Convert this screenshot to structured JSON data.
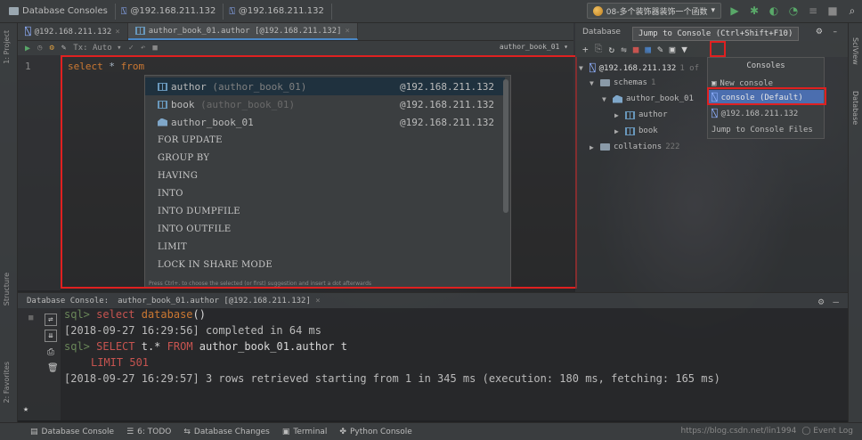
{
  "navbar": {
    "crumbs": [
      "Database Consoles",
      "@192.168.211.132",
      "@192.168.211.132"
    ],
    "connection_dropdown": "08-多个装饰器装饰一个函数"
  },
  "left_strip": {
    "project": "1: Project",
    "structure": "Structure",
    "favorites": "2: Favorites"
  },
  "right_strip": {
    "sciview": "SciView",
    "database": "Database"
  },
  "editor": {
    "tabs": [
      {
        "label": "@192.168.211.132",
        "active": false
      },
      {
        "label": "author_book_01.author [@192.168.211.132]",
        "active": true
      }
    ],
    "tx_label": "Tx: Auto",
    "schema_selector": "author_book_01",
    "line_number": "1",
    "code": {
      "select": "select",
      "star": "*",
      "from": "from"
    }
  },
  "completion": {
    "items": [
      {
        "name": "author",
        "detail": "(author_book_01)",
        "source": "@192.168.211.132",
        "type": "table"
      },
      {
        "name": "book",
        "detail": "(author_book_01)",
        "source": "@192.168.211.132",
        "type": "table"
      },
      {
        "name": "author_book_01",
        "detail": "",
        "source": "@192.168.211.132",
        "type": "schema"
      }
    ],
    "keywords": [
      "FOR UPDATE",
      "GROUP BY",
      "HAVING",
      "INTO",
      "INTO DUMPFILE",
      "INTO OUTFILE",
      "LIMIT",
      "LOCK IN SHARE MODE"
    ],
    "hint": "Press Ctrl+. to choose the selected (or first) suggestion and insert a dot afterwards"
  },
  "database_panel": {
    "title": "Database",
    "tooltip": "Jump to Console (Ctrl+Shift+F10)",
    "tree": {
      "root": {
        "label": "@192.168.211.132",
        "count": "1 of"
      },
      "schemas": {
        "label": "schemas",
        "count": "1"
      },
      "schema": {
        "label": "author_book_01"
      },
      "tables": [
        "author",
        "book"
      ],
      "collations": {
        "label": "collations",
        "count": "222"
      }
    },
    "consoles_popup": {
      "title": "Consoles",
      "new_console": "New console",
      "default_console": "console (Default)",
      "host": "@192.168.211.132",
      "jump": "Jump to Console Files"
    }
  },
  "console": {
    "tab_title": "Database Console:",
    "tab_label": "author_book_01.author [@192.168.211.132]",
    "lines": {
      "p1": "sql>",
      "k1": "select",
      "f1": "database",
      "r1": "()",
      "l2": "[2018-09-27 16:29:56] completed in 64 ms",
      "p3": "sql>",
      "k3": "SELECT",
      "m3": "t.*",
      "k3b": "FROM",
      "r3": "author_book_01.author t",
      "k4": "LIMIT 501",
      "l5": "[2018-09-27 16:29:57] 3 rows retrieved starting from 1 in 345 ms (execution: 180 ms, fetching: 165 ms)"
    }
  },
  "bottombar": {
    "items": [
      "Database Console",
      "6: TODO",
      "Database Changes",
      "Terminal",
      "Python Console"
    ],
    "watermark": "https://blog.csdn.net/lin1994",
    "event_log": "Event Log"
  },
  "colors": {
    "keyword": "#cc7832",
    "selection": "#4b6eaf",
    "highlight_box": "#e02020",
    "sql_keyword": "#c75450"
  }
}
